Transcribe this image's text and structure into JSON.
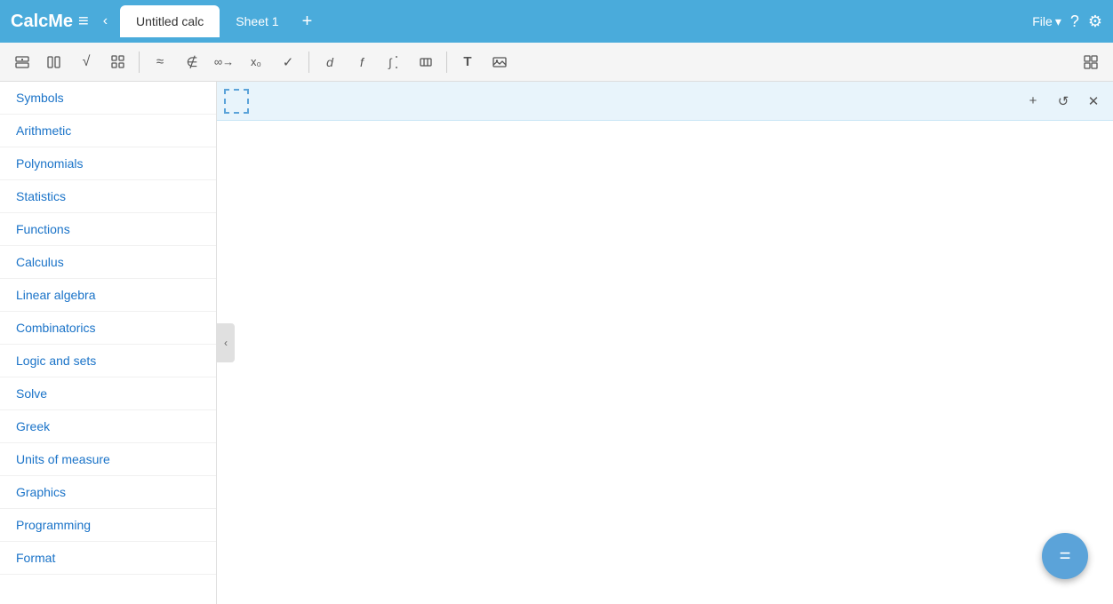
{
  "header": {
    "logo_text": "CalcMe",
    "logo_symbol": "≡",
    "collapse_icon": "‹",
    "doc_title": "Untitled calc",
    "tab_sheet": "Sheet 1",
    "tab_add": "+",
    "file_label": "File",
    "file_arrow": "▾",
    "help_icon": "?",
    "settings_icon": "⚙"
  },
  "toolbar": {
    "buttons": [
      {
        "name": "insert-row",
        "icon": "⊞",
        "symbol": "⊤"
      },
      {
        "name": "insert-col",
        "icon": "▣",
        "symbol": "▣"
      },
      {
        "name": "sqrt",
        "icon": "√",
        "symbol": "√"
      },
      {
        "name": "matrix",
        "icon": "⊡",
        "symbol": "⊡"
      },
      {
        "name": "approx",
        "icon": "≈",
        "symbol": "≈"
      },
      {
        "name": "not-elem",
        "icon": "∉",
        "symbol": "∉"
      },
      {
        "name": "infinity",
        "icon": "∞",
        "symbol": "∞"
      },
      {
        "name": "subscript",
        "icon": "x₀",
        "symbol": "x₀"
      },
      {
        "name": "checkmark",
        "icon": "✓",
        "symbol": "✓"
      },
      {
        "name": "derivative",
        "icon": "d",
        "symbol": "d"
      },
      {
        "name": "function",
        "icon": "f",
        "symbol": "f"
      },
      {
        "name": "integral-down",
        "icon": "↓∫",
        "symbol": "↓"
      },
      {
        "name": "special",
        "icon": "⟨⟩",
        "symbol": "⟨⟩"
      },
      {
        "name": "text",
        "icon": "T",
        "symbol": "T"
      },
      {
        "name": "image",
        "icon": "🖼",
        "symbol": "🖼"
      }
    ],
    "right_icon": "⊞"
  },
  "sidebar": {
    "items": [
      {
        "label": "Symbols",
        "id": "symbols"
      },
      {
        "label": "Arithmetic",
        "id": "arithmetic"
      },
      {
        "label": "Polynomials",
        "id": "polynomials"
      },
      {
        "label": "Statistics",
        "id": "statistics"
      },
      {
        "label": "Functions",
        "id": "functions"
      },
      {
        "label": "Calculus",
        "id": "calculus"
      },
      {
        "label": "Linear algebra",
        "id": "linear-algebra"
      },
      {
        "label": "Combinatorics",
        "id": "combinatorics"
      },
      {
        "label": "Logic and sets",
        "id": "logic-and-sets"
      },
      {
        "label": "Solve",
        "id": "solve"
      },
      {
        "label": "Greek",
        "id": "greek"
      },
      {
        "label": "Units of measure",
        "id": "units-of-measure"
      },
      {
        "label": "Graphics",
        "id": "graphics"
      },
      {
        "label": "Programming",
        "id": "programming"
      },
      {
        "label": "Format",
        "id": "format"
      }
    ]
  },
  "content": {
    "add_icon": "+",
    "refresh_icon": "↺",
    "close_icon": "✕",
    "fab_icon": "="
  }
}
